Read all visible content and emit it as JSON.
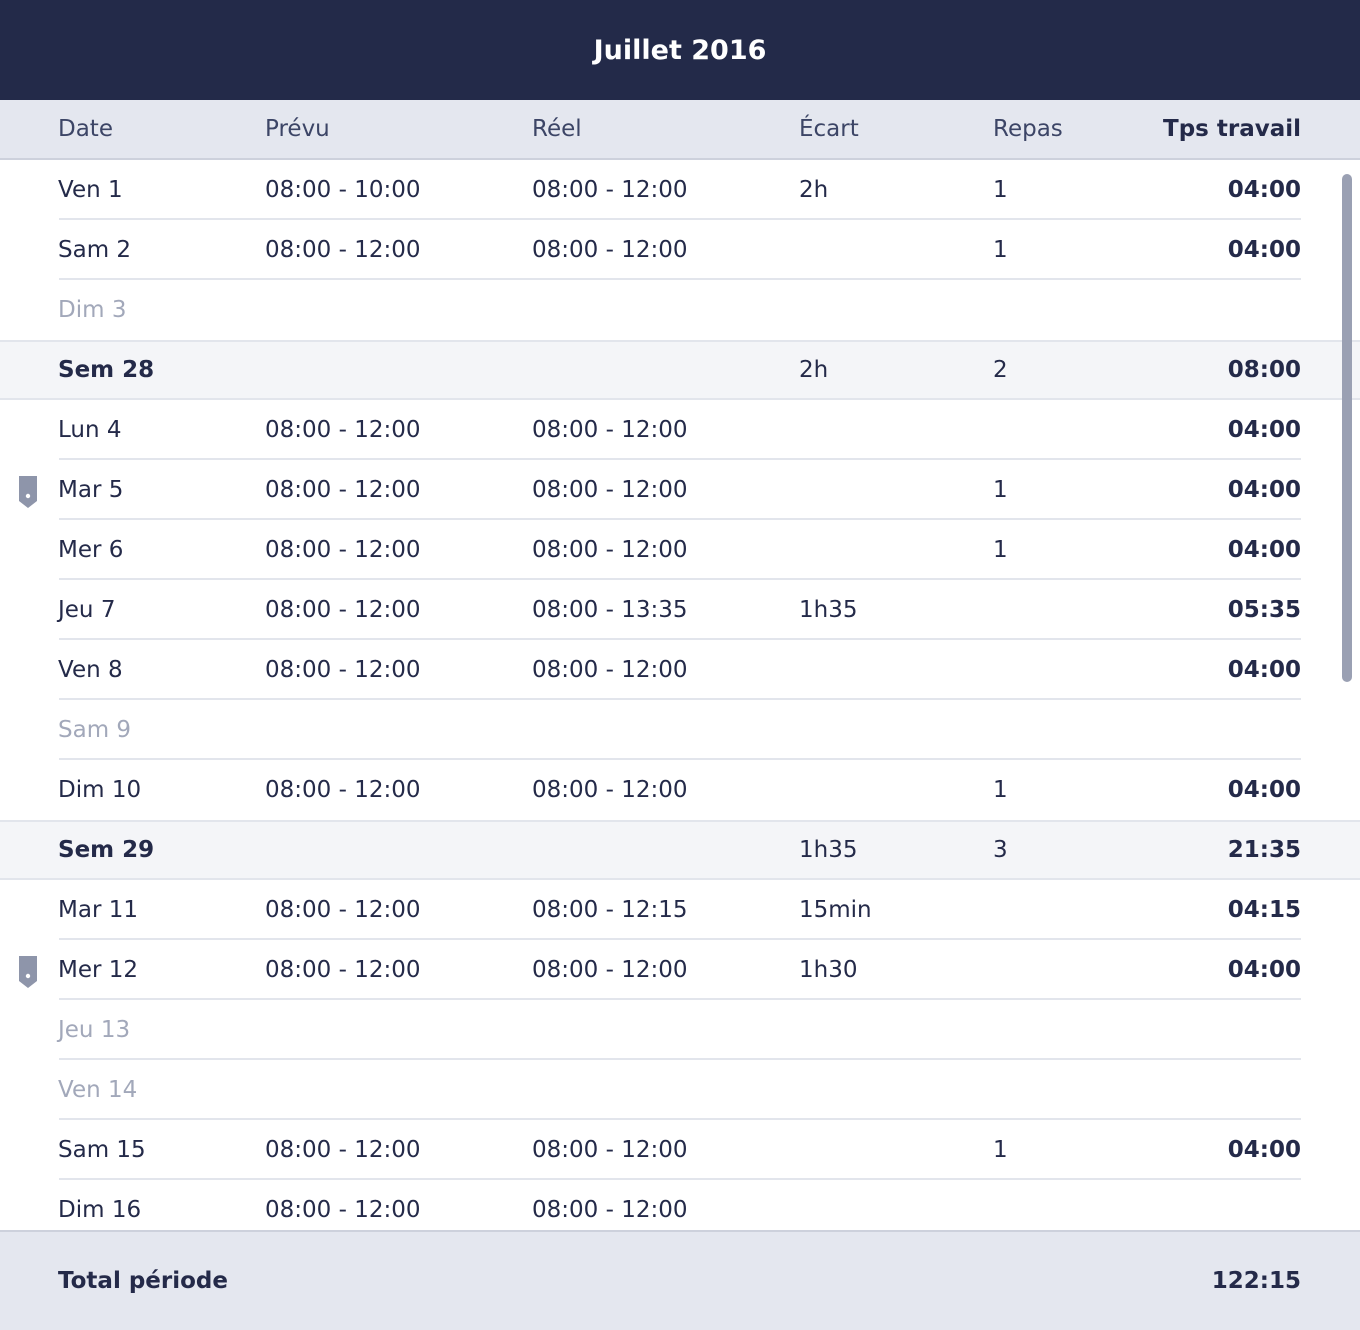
{
  "header": {
    "title": "Juillet 2016"
  },
  "columns": {
    "date": "Date",
    "prevu": "Prévu",
    "reel": "Réel",
    "ecart": "Écart",
    "repas": "Repas",
    "tps": "Tps travail"
  },
  "rows": [
    {
      "type": "day",
      "date": "Ven 1",
      "prevu": "08:00 - 10:00",
      "reel": "08:00 - 12:00",
      "ecart": "2h",
      "repas": "1",
      "tps": "04:00",
      "off": false,
      "flag": false
    },
    {
      "type": "day",
      "date": "Sam 2",
      "prevu": "08:00 - 12:00",
      "reel": "08:00 - 12:00",
      "ecart": "",
      "repas": "1",
      "tps": "04:00",
      "off": false,
      "flag": false
    },
    {
      "type": "day",
      "date": "Dim 3",
      "prevu": "",
      "reel": "",
      "ecart": "",
      "repas": "",
      "tps": "",
      "off": true,
      "flag": false
    },
    {
      "type": "week",
      "date": "Sem 28",
      "prevu": "",
      "reel": "",
      "ecart": "2h",
      "repas": "2",
      "tps": "08:00"
    },
    {
      "type": "day",
      "date": "Lun 4",
      "prevu": "08:00 - 12:00",
      "reel": "08:00 - 12:00",
      "ecart": "",
      "repas": "",
      "tps": "04:00",
      "off": false,
      "flag": false
    },
    {
      "type": "day",
      "date": "Mar 5",
      "prevu": "08:00 - 12:00",
      "reel": "08:00 - 12:00",
      "ecart": "",
      "repas": "1",
      "tps": "04:00",
      "off": false,
      "flag": true
    },
    {
      "type": "day",
      "date": "Mer 6",
      "prevu": "08:00 - 12:00",
      "reel": "08:00 - 12:00",
      "ecart": "",
      "repas": "1",
      "tps": "04:00",
      "off": false,
      "flag": false
    },
    {
      "type": "day",
      "date": "Jeu 7",
      "prevu": "08:00 - 12:00",
      "reel": "08:00 - 13:35",
      "ecart": "1h35",
      "repas": "",
      "tps": "05:35",
      "off": false,
      "flag": false
    },
    {
      "type": "day",
      "date": "Ven 8",
      "prevu": "08:00 - 12:00",
      "reel": "08:00 - 12:00",
      "ecart": "",
      "repas": "",
      "tps": "04:00",
      "off": false,
      "flag": false
    },
    {
      "type": "day",
      "date": "Sam 9",
      "prevu": "",
      "reel": "",
      "ecart": "",
      "repas": "",
      "tps": "",
      "off": true,
      "flag": false
    },
    {
      "type": "day",
      "date": "Dim 10",
      "prevu": "08:00 - 12:00",
      "reel": "08:00 - 12:00",
      "ecart": "",
      "repas": "1",
      "tps": "04:00",
      "off": false,
      "flag": false
    },
    {
      "type": "week",
      "date": "Sem 29",
      "prevu": "",
      "reel": "",
      "ecart": "1h35",
      "repas": "3",
      "tps": "21:35"
    },
    {
      "type": "day",
      "date": "Mar 11",
      "prevu": "08:00 - 12:00",
      "reel": "08:00 - 12:15",
      "ecart": "15min",
      "repas": "",
      "tps": "04:15",
      "off": false,
      "flag": false
    },
    {
      "type": "day",
      "date": "Mer 12",
      "prevu": "08:00 - 12:00",
      "reel": "08:00 - 12:00",
      "ecart": "1h30",
      "repas": "",
      "tps": "04:00",
      "off": false,
      "flag": true
    },
    {
      "type": "day",
      "date": "Jeu 13",
      "prevu": "",
      "reel": "",
      "ecart": "",
      "repas": "",
      "tps": "",
      "off": true,
      "flag": false
    },
    {
      "type": "day",
      "date": "Ven 14",
      "prevu": "",
      "reel": "",
      "ecart": "",
      "repas": "",
      "tps": "",
      "off": true,
      "flag": false
    },
    {
      "type": "day",
      "date": "Sam 15",
      "prevu": "08:00 - 12:00",
      "reel": "08:00 - 12:00",
      "ecart": "",
      "repas": "1",
      "tps": "04:00",
      "off": false,
      "flag": false
    },
    {
      "type": "day",
      "date": "Dim 16",
      "prevu": "08:00 - 12:00",
      "reel": "08:00 - 12:00",
      "ecart": "",
      "repas": "",
      "tps": "",
      "off": false,
      "flag": false
    }
  ],
  "footer": {
    "label": "Total période",
    "total": "122:15"
  },
  "icons": {
    "flag": "bookmark-icon"
  },
  "colors": {
    "header_bg": "#232a49",
    "flag": "#8e95aa",
    "muted_text": "#a2a8ba"
  }
}
